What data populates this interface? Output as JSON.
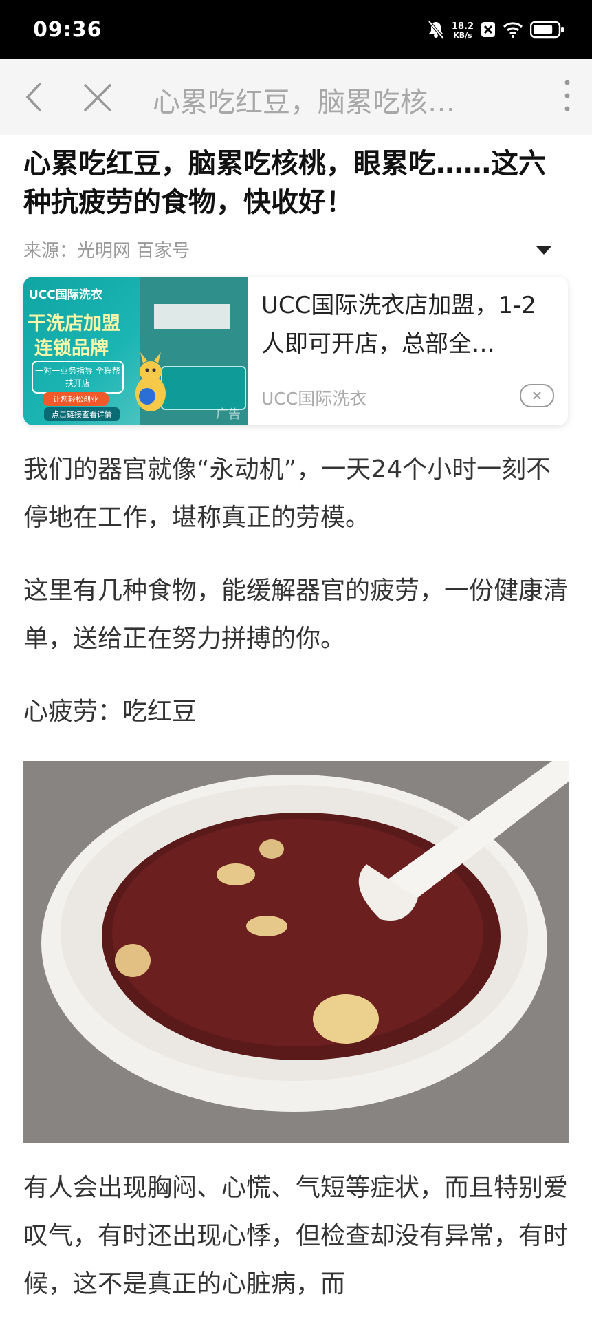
{
  "status_bar": {
    "time": "09:36",
    "net_speed_value": "18.2",
    "net_speed_unit": "KB/s",
    "battery_level": 0.8
  },
  "nav": {
    "title": "心累吃红豆，脑累吃核…"
  },
  "article": {
    "headline": "心累吃红豆，脑累吃核桃，眼累吃……这六种抗疲劳的食物，快收好！",
    "source": "来源：光明网 百家号"
  },
  "ad": {
    "image_brand": "UCC国际洗衣",
    "image_line1": "干洗店加盟",
    "image_line2": "连锁品牌",
    "image_pill1": "一对一业务指导 全程帮扶开店",
    "image_pill2": "让您轻松创业",
    "image_pill3": "点击链接查看详情",
    "image_tag": "广告",
    "text": "UCC国际洗衣店加盟，1-2人即可开店，总部全…",
    "source": "UCC国际洗衣"
  },
  "content": {
    "p1": "我们的器官就像“永动机”，一天24个小时一刻不停地在工作，堪称真正的劳模。",
    "p2": "这里有几种食物，能缓解器官的疲劳，一份健康清单，送给正在努力拼搏的你。",
    "p3": "心疲劳：吃红豆",
    "p4": "有人会出现胸闷、心慌、气短等症状，而且特别爱叹气，有时还出现心悸，但检查却没有异常，有时候，这不是真正的心脏病，而"
  },
  "colors": {
    "status_bg": "#000000",
    "nav_bg": "#f5f5f5",
    "ad_teal": "#1bb5b3"
  }
}
